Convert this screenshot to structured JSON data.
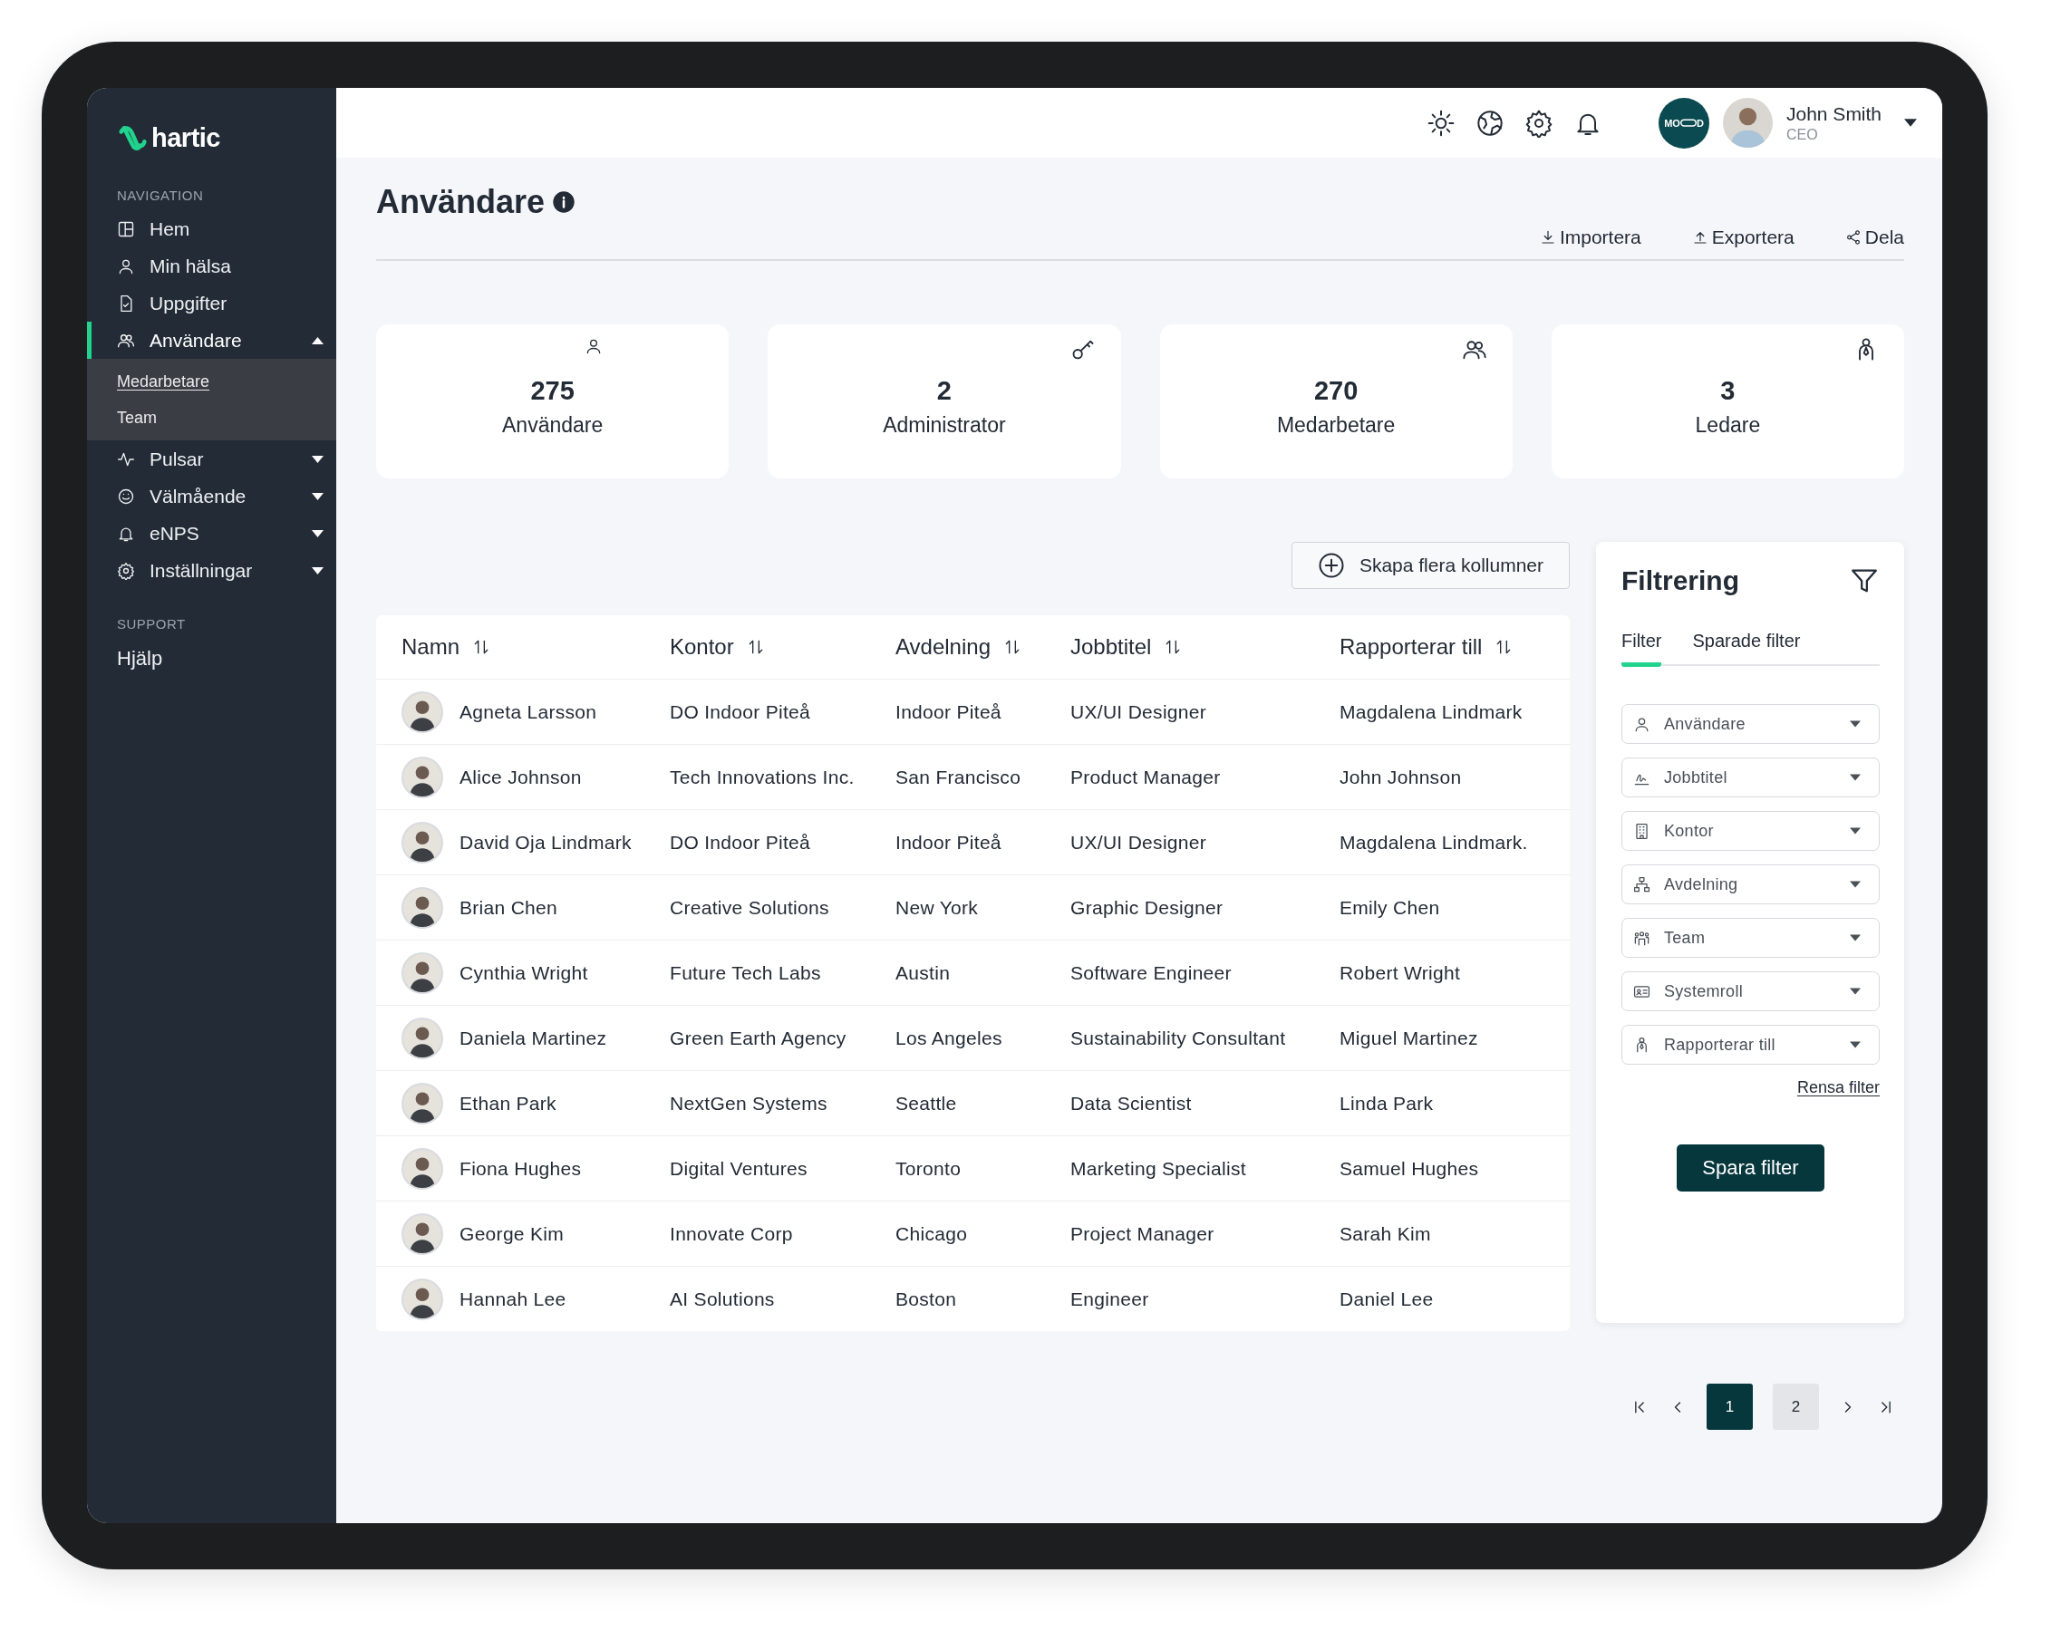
{
  "brand": {
    "name": "hartic"
  },
  "sidebar": {
    "sections": [
      {
        "heading": "NAVIGATION",
        "items": [
          {
            "label": "Hem",
            "selected": false
          },
          {
            "label": "Min hälsa",
            "selected": false
          },
          {
            "label": "Uppgifter",
            "selected": false
          },
          {
            "label": "Användare",
            "selected": true,
            "expanded": true,
            "children": [
              {
                "label": "Medarbetare",
                "selected": true
              },
              {
                "label": "Team",
                "selected": false
              }
            ]
          },
          {
            "label": "Pulsar",
            "selected": false,
            "expanded": false
          },
          {
            "label": "Välmående",
            "selected": false,
            "expanded": false
          },
          {
            "label": "eNPS",
            "selected": false,
            "expanded": false
          },
          {
            "label": "Inställningar",
            "selected": false,
            "expanded": false
          }
        ]
      },
      {
        "heading": "SUPPORT",
        "items": [
          {
            "label": "Hjälp",
            "selected": false
          }
        ]
      }
    ]
  },
  "topbar": {
    "org_logo": {
      "prefix": "MO",
      "suffix": "D"
    },
    "user": {
      "name": "John Smith",
      "role": "CEO"
    }
  },
  "page": {
    "title": "Användare",
    "actions": [
      "Importera",
      "Exportera",
      "Dela"
    ]
  },
  "stats": [
    {
      "value": "275",
      "label": "Användare"
    },
    {
      "value": "2",
      "label": "Administrator"
    },
    {
      "value": "270",
      "label": "Medarbetare"
    },
    {
      "value": "3",
      "label": "Ledare"
    }
  ],
  "add_columns_button": "Skapa flera kollumner",
  "table": {
    "columns": [
      "Namn",
      "Kontor",
      "Avdelning",
      "Jobbtitel",
      "Rapporterar till"
    ],
    "rows": [
      [
        "Agneta Larsson",
        "DO Indoor Piteå",
        "Indoor Piteå",
        "UX/UI Designer",
        "Magdalena Lindmark"
      ],
      [
        "Alice Johnson",
        "Tech Innovations Inc.",
        "San Francisco",
        "Product Manager",
        "John Johnson"
      ],
      [
        "David Oja Lindmark",
        "DO Indoor Piteå",
        "Indoor Piteå",
        "UX/UI Designer",
        "Magdalena Lindmark."
      ],
      [
        "Brian Chen",
        "Creative Solutions",
        "New York",
        "Graphic Designer",
        "Emily Chen"
      ],
      [
        "Cynthia Wright",
        "Future Tech Labs",
        "Austin",
        "Software Engineer",
        "Robert Wright"
      ],
      [
        "Daniela Martinez",
        "Green Earth Agency",
        "Los Angeles",
        "Sustainability Consultant",
        "Miguel Martinez"
      ],
      [
        "Ethan Park",
        "NextGen Systems",
        "Seattle",
        "Data Scientist",
        "Linda Park"
      ],
      [
        "Fiona Hughes",
        "Digital Ventures",
        "Toronto",
        "Marketing Specialist",
        "Samuel Hughes"
      ],
      [
        "George Kim",
        "Innovate Corp",
        "Chicago",
        "Project Manager",
        "Sarah Kim"
      ],
      [
        "Hannah Lee",
        "AI Solutions",
        "Boston",
        "Engineer",
        "Daniel Lee"
      ]
    ]
  },
  "filter_panel": {
    "title": "Filtrering",
    "tabs": [
      {
        "label": "Filter",
        "selected": true
      },
      {
        "label": "Sparade filter",
        "selected": false
      }
    ],
    "dropdowns": [
      "Användare",
      "Jobbtitel",
      "Kontor",
      "Avdelning",
      "Team",
      "Systemroll",
      "Rapporterar till"
    ],
    "clear_link": "Rensa filter",
    "save_button": "Spara filter"
  },
  "pagination": {
    "pages": [
      {
        "label": "1",
        "selected": true
      },
      {
        "label": "2",
        "selected": false
      }
    ]
  }
}
